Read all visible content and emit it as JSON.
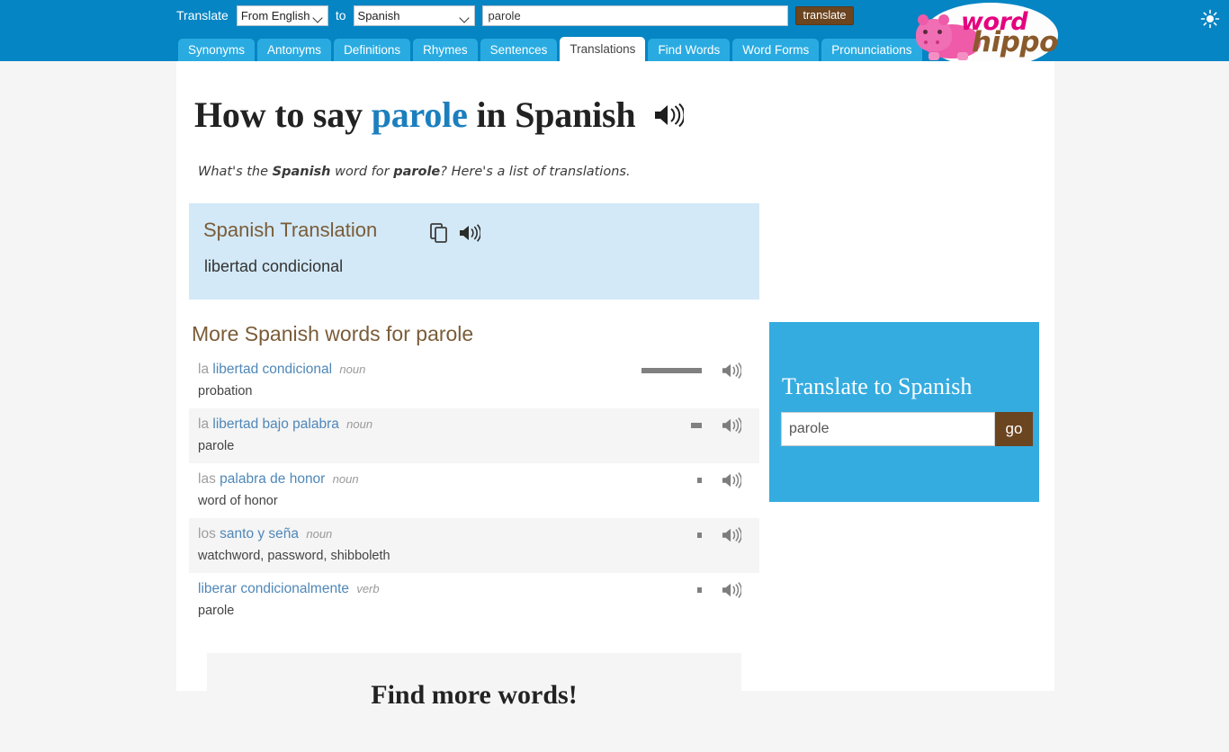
{
  "header": {
    "translate_label": "Translate",
    "from_select": {
      "value": "From English",
      "options": [
        "From English"
      ]
    },
    "to_word": "to",
    "to_select": {
      "value": "Spanish",
      "options": [
        "Spanish"
      ]
    },
    "search_value": "parole",
    "search_placeholder": "",
    "translate_button": "translate",
    "theme_toggle_icon": "sun-icon",
    "logo": {
      "word": "word",
      "hippo": "hippo"
    },
    "tabs": [
      {
        "label": "Synonyms",
        "active": false
      },
      {
        "label": "Antonyms",
        "active": false
      },
      {
        "label": "Definitions",
        "active": false
      },
      {
        "label": "Rhymes",
        "active": false
      },
      {
        "label": "Sentences",
        "active": false
      },
      {
        "label": "Translations",
        "active": true
      },
      {
        "label": "Find Words",
        "active": false
      },
      {
        "label": "Word Forms",
        "active": false
      },
      {
        "label": "Pronunciations",
        "active": false
      }
    ]
  },
  "main": {
    "title_prefix": "How to say ",
    "title_keyword": "parole",
    "title_suffix": " in Spanish",
    "title_speaker_icon": "speaker-icon",
    "subtitle_part1": "What's the ",
    "subtitle_lang": "Spanish",
    "subtitle_part2": " word for ",
    "subtitle_word": "parole",
    "subtitle_part3": "? Here's a list of translations.",
    "card": {
      "title": "Spanish Translation",
      "copy_icon": "copy-icon",
      "speaker_icon": "speaker-icon",
      "value": "libertad condicional"
    },
    "more_words_title": "More Spanish words for parole",
    "words": [
      {
        "article": "la",
        "word": "libertad condicional",
        "pos": "noun",
        "meaning": "probation",
        "freq": 67
      },
      {
        "article": "la",
        "word": "libertad bajo palabra",
        "pos": "noun",
        "meaning": "parole",
        "freq": 12
      },
      {
        "article": "las",
        "word": "palabra de honor",
        "pos": "noun",
        "meaning": "word of honor",
        "freq": 5
      },
      {
        "article": "los",
        "word": "santo y seña",
        "pos": "noun",
        "meaning": "watchword, password, shibboleth",
        "freq": 5
      },
      {
        "article": "",
        "word": "liberar condicionalmente",
        "pos": "verb",
        "meaning": "parole",
        "freq": 5
      }
    ],
    "find_more_title": "Find more words!"
  },
  "widget": {
    "title": "Translate to Spanish",
    "input_value": "parole",
    "input_placeholder": "",
    "go_button": "go"
  },
  "colors": {
    "header_blue": "#0585c4",
    "tab_blue": "#29abe2",
    "brown": "#6b4420",
    "card_blue": "#d3e9f7",
    "widget_blue": "#35ace0",
    "link_blue": "#4f87b8",
    "heading_brown": "#7a5c38"
  }
}
